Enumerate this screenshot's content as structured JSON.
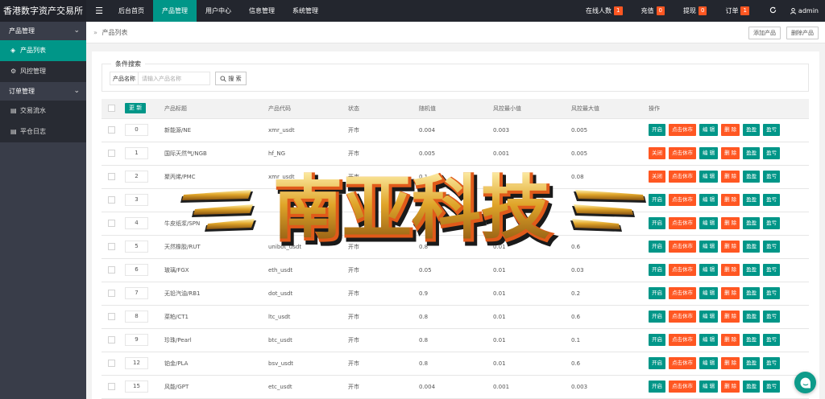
{
  "header": {
    "brand": "香港数字资产交易所",
    "menu_toggle": "☰",
    "nav": [
      {
        "label": "后台首页",
        "active": false
      },
      {
        "label": "产品管理",
        "active": true
      },
      {
        "label": "用户中心",
        "active": false
      },
      {
        "label": "信息管理",
        "active": false
      },
      {
        "label": "系统管理",
        "active": false
      }
    ],
    "stats": [
      {
        "label": "在线人数",
        "value": "1"
      },
      {
        "label": "充值",
        "value": "0"
      },
      {
        "label": "提现",
        "value": "0"
      },
      {
        "label": "订单",
        "value": "1"
      }
    ],
    "refresh_icon": "refresh-icon",
    "user": "admin"
  },
  "sidebar": {
    "groups": [
      {
        "label": "产品管理",
        "expanded": true,
        "items": [
          {
            "label": "产品列表",
            "icon": "cube-icon",
            "active": true
          },
          {
            "label": "风控管理",
            "icon": "gear-icon",
            "active": false
          }
        ]
      },
      {
        "label": "订单管理",
        "expanded": true,
        "items": [
          {
            "label": "交易流水",
            "icon": "document-icon",
            "active": false
          },
          {
            "label": "平仓日志",
            "icon": "document-icon",
            "active": false
          }
        ]
      }
    ]
  },
  "breadcrumb": {
    "separator": "»",
    "label": "产品列表"
  },
  "toolbar": {
    "add_label": "添加产品",
    "delete_label": "删除产品"
  },
  "search": {
    "legend": "条件搜索",
    "field_label": "产品名称",
    "placeholder": "请输入产品名称",
    "button_label": "搜 索"
  },
  "table": {
    "update_label": "更 新",
    "columns": [
      "产品标题",
      "产品代码",
      "状态",
      "随机值",
      "风控最小值",
      "风控最大值",
      "操作"
    ],
    "rows": [
      {
        "order": "0",
        "title": "新能源/NE",
        "code": "xmr_usdt",
        "status": "开市",
        "random": "0.004",
        "min": "0.003",
        "max": "0.005",
        "toggle": "开启",
        "toggle_color": "teal"
      },
      {
        "order": "1",
        "title": "国际天然气/NGB",
        "code": "hf_NG",
        "status": "开市",
        "random": "0.005",
        "min": "0.001",
        "max": "0.005",
        "toggle": "关闭",
        "toggle_color": "red"
      },
      {
        "order": "2",
        "title": "聚丙烯/PMC",
        "code": "xmr_usdt",
        "status": "开市",
        "random": "0.1",
        "min": "0.01",
        "max": "0.08",
        "toggle": "关闭",
        "toggle_color": "red"
      },
      {
        "order": "3",
        "title": "",
        "code": "",
        "status": "",
        "random": "",
        "min": "",
        "max": "",
        "toggle": "开启",
        "toggle_color": "teal"
      },
      {
        "order": "4",
        "title": "牛皮纸浆/SPN",
        "code": "",
        "status": "",
        "random": "",
        "min": "",
        "max": "",
        "toggle": "开启",
        "toggle_color": "teal"
      },
      {
        "order": "5",
        "title": "天然橡胶/RUT",
        "code": "unibot_usdt",
        "status": "开市",
        "random": "0.8",
        "min": "0.01",
        "max": "0.6",
        "toggle": "开启",
        "toggle_color": "teal"
      },
      {
        "order": "6",
        "title": "玻璃/FGX",
        "code": "eth_usdt",
        "status": "开市",
        "random": "0.05",
        "min": "0.01",
        "max": "0.03",
        "toggle": "开启",
        "toggle_color": "teal"
      },
      {
        "order": "7",
        "title": "无铅汽油/RB1",
        "code": "dot_usdt",
        "status": "开市",
        "random": "0.9",
        "min": "0.01",
        "max": "0.2",
        "toggle": "开启",
        "toggle_color": "teal"
      },
      {
        "order": "8",
        "title": "菜粕/CT1",
        "code": "ltc_usdt",
        "status": "开市",
        "random": "0.8",
        "min": "0.01",
        "max": "0.6",
        "toggle": "开启",
        "toggle_color": "teal"
      },
      {
        "order": "9",
        "title": "珍珠/Pearl",
        "code": "btc_usdt",
        "status": "开市",
        "random": "0.8",
        "min": "0.01",
        "max": "0.1",
        "toggle": "开启",
        "toggle_color": "teal"
      },
      {
        "order": "12",
        "title": "铂金/PLA",
        "code": "bsv_usdt",
        "status": "开市",
        "random": "0.8",
        "min": "0.01",
        "max": "0.6",
        "toggle": "开启",
        "toggle_color": "teal"
      },
      {
        "order": "15",
        "title": "风能/GPT",
        "code": "etc_usdt",
        "status": "开市",
        "random": "0.004",
        "min": "0.001",
        "max": "0.003",
        "toggle": "开启",
        "toggle_color": "teal"
      }
    ],
    "ops": {
      "close_market": "点击休市",
      "edit": "编 辑",
      "delete": "删 除",
      "profit": "盈盈",
      "loss": "盈亏"
    }
  },
  "watermark": {
    "text": "南亚科技"
  },
  "float": {
    "icon": "chat-icon"
  }
}
